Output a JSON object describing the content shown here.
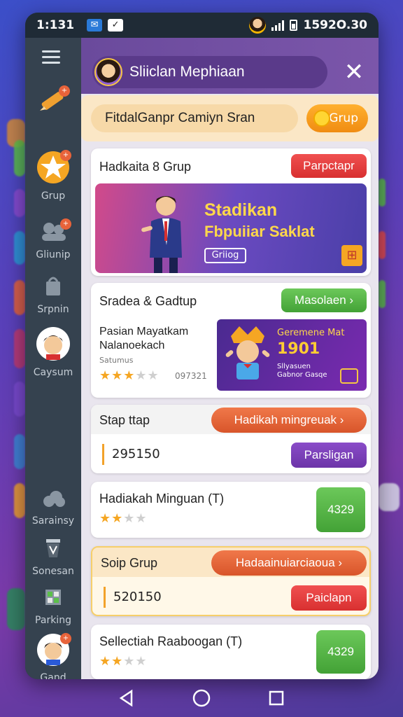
{
  "status_bar": {
    "time": "1:131",
    "right_text": "1592O.30"
  },
  "header": {
    "title": "Sliiclan Mephiaan",
    "close_icon": "close-icon"
  },
  "search": {
    "text": "FitdalGanpr Camiyn Sran",
    "button_label": "Grup"
  },
  "sidenav": {
    "items": [
      {
        "label": "",
        "icon": "pencil-icon"
      },
      {
        "label": "Grup",
        "icon": "star-icon"
      },
      {
        "label": "Gliunip",
        "icon": "group-icon"
      },
      {
        "label": "Srpnin",
        "icon": "shop-icon"
      },
      {
        "label": "Caysum",
        "icon": "avatar-icon"
      },
      {
        "label": "Sarainsy",
        "icon": "cloud-icon"
      },
      {
        "label": "Sonesan",
        "icon": "bucket-icon"
      },
      {
        "label": "Parking",
        "icon": "grid-icon"
      },
      {
        "label": "Gand",
        "icon": "avatar-icon"
      }
    ]
  },
  "cards": {
    "group_card": {
      "title": "Hadkaita 8 Grup",
      "button": "Parpctapr",
      "banner_line1": "Stadikan",
      "banner_line2": "Fbpuiiar Saklat",
      "banner_button": "Griiog"
    },
    "game_card": {
      "title": "Sradea & Gadtup",
      "button": "Masolaen",
      "item_name": "Pasian Mayatkam Nalanoekach",
      "item_sub": "Satumus",
      "rating": 3,
      "count": "097321",
      "promo_line1": "Geremene Mat",
      "promo_line2": "1901",
      "promo_line3": "Sllyasuen Gabnor Gasqe"
    },
    "stap_card": {
      "title": "Stap ttap",
      "button": "Hadikah mingreuak",
      "value": "295150",
      "action": "Parsligan"
    },
    "hadiakah_card": {
      "title": "Hadiakah Minguan (T)",
      "rating": 2,
      "value": "4329"
    },
    "soip_card": {
      "title": "Soip Grup",
      "button": "Hadaainuiarciaoua",
      "value": "520150",
      "action": "Paiclapn"
    },
    "select_card": {
      "title": "Sellectiah Raaboogan (T)",
      "rating": 2,
      "value": "4329"
    }
  },
  "colors": {
    "accent_purple": "#7b56aa",
    "orange": "#e8633a",
    "green": "#43a236"
  }
}
